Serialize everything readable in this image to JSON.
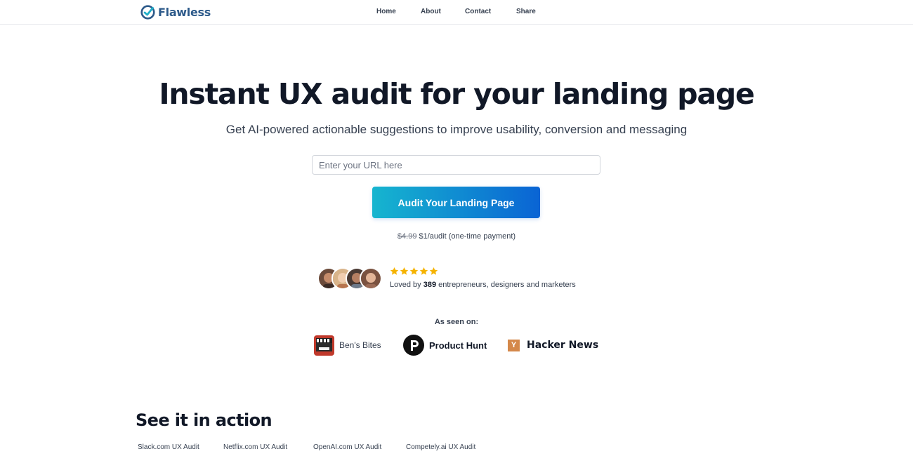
{
  "brand": {
    "name": "Flawless"
  },
  "nav": {
    "items": [
      "Home",
      "About",
      "Contact",
      "Share"
    ]
  },
  "hero": {
    "title": "Instant UX audit for your landing page",
    "subtitle": "Get AI-powered actionable suggestions to improve usability, conversion and messaging"
  },
  "url_input": {
    "placeholder": "Enter your URL here",
    "value": ""
  },
  "cta": {
    "label": "Audit Your Landing Page"
  },
  "pricing": {
    "old_price": "$4.99",
    "new_price": "$1/audit (one-time payment)"
  },
  "social_proof": {
    "rating_stars": 5,
    "loved_prefix": "Loved by",
    "count": "389",
    "loved_suffix": "entrepreneurs, designers and marketers"
  },
  "as_seen_on": {
    "label": "As seen on:",
    "items": [
      {
        "name": "Ben's Bites",
        "icon": "bens-bites-icon"
      },
      {
        "name": "Product Hunt",
        "icon": "product-hunt-icon"
      },
      {
        "name": "Hacker News",
        "icon": "hacker-news-icon",
        "badge": "Y"
      }
    ]
  },
  "see_it_in_action": {
    "title": "See it in action",
    "tabs": [
      "Slack.com UX Audit",
      "Netflix.com UX Audit",
      "OpenAI.com UX Audit",
      "Competely.ai UX Audit"
    ]
  },
  "colors": {
    "brand": "#2d5a8a",
    "cta_start": "#16b5cf",
    "cta_end": "#0a64d4",
    "star": "#f5b301",
    "hacker_news": "#d4884a"
  }
}
